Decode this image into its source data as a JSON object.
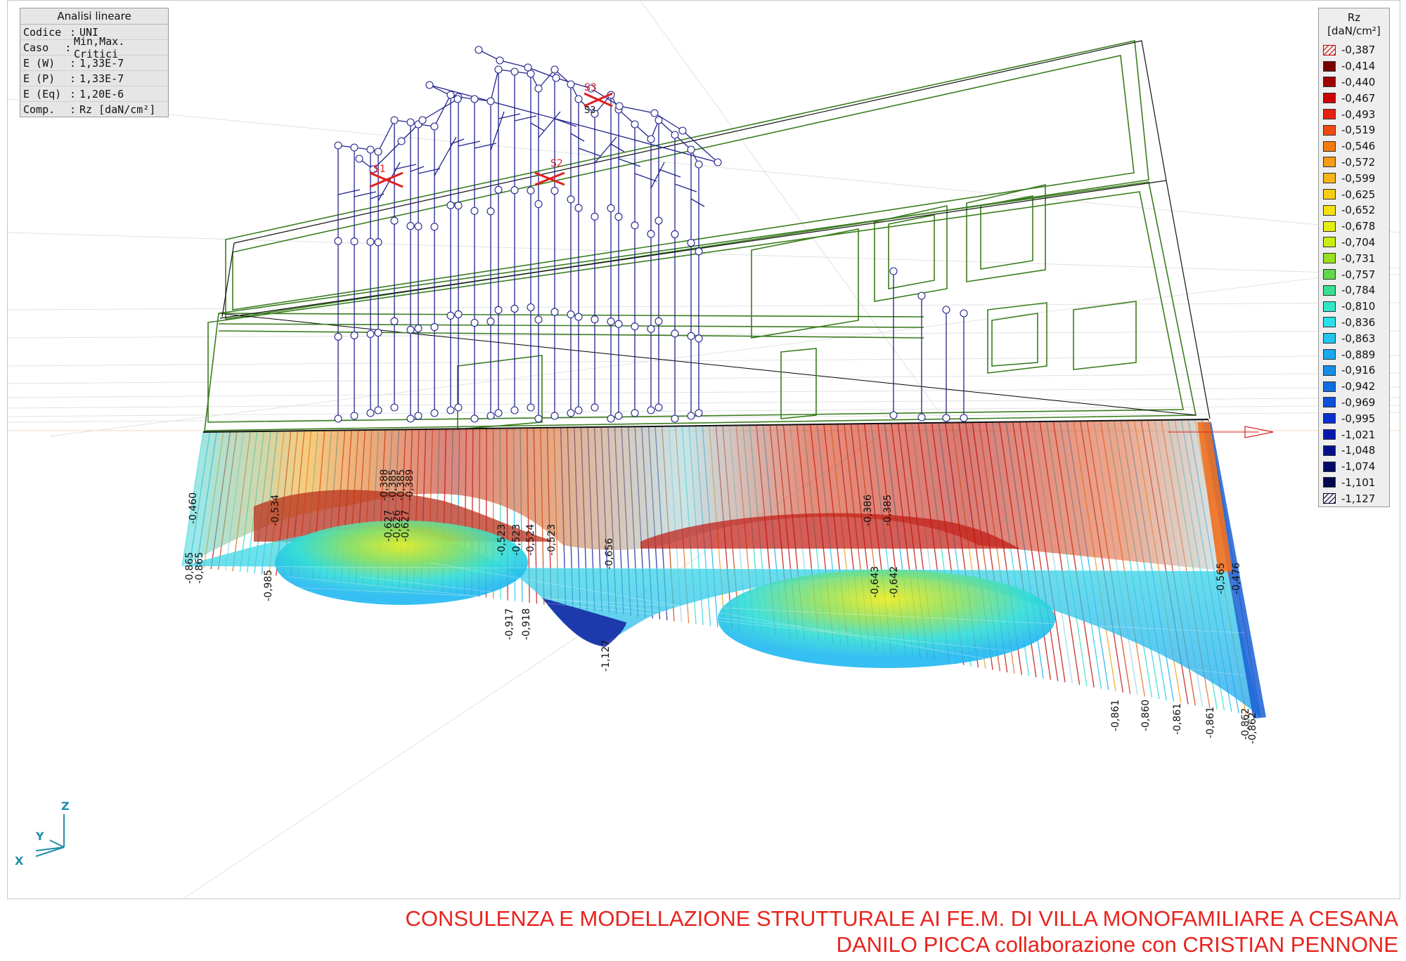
{
  "info_panel": {
    "title": "Analisi lineare",
    "rows": [
      {
        "key": "Codice",
        "value": "UNI"
      },
      {
        "key": "Caso",
        "value": "Min,Max. Critici"
      },
      {
        "key": "E (W)",
        "value": "1,33E-7"
      },
      {
        "key": "E (P)",
        "value": "1,33E-7"
      },
      {
        "key": "E (Eq)",
        "value": "1,20E-6"
      },
      {
        "key": "Comp.",
        "value": "Rz [daN/cm²]"
      }
    ]
  },
  "legend": {
    "title": "Rz",
    "unit": "[daN/cm²]",
    "items": [
      {
        "label": "-0,387",
        "color": "#c00000",
        "hatch": true
      },
      {
        "label": "-0,414",
        "color": "#7a0000"
      },
      {
        "label": "-0,440",
        "color": "#a00000"
      },
      {
        "label": "-0,467",
        "color": "#cc0000"
      },
      {
        "label": "-0,493",
        "color": "#e82010"
      },
      {
        "label": "-0,519",
        "color": "#f04a10"
      },
      {
        "label": "-0,546",
        "color": "#f57a10"
      },
      {
        "label": "-0,572",
        "color": "#f79a18"
      },
      {
        "label": "-0,599",
        "color": "#f8b418"
      },
      {
        "label": "-0,625",
        "color": "#f9cc14"
      },
      {
        "label": "-0,652",
        "color": "#f4e010"
      },
      {
        "label": "-0,678",
        "color": "#e4ee10"
      },
      {
        "label": "-0,704",
        "color": "#c6ee10"
      },
      {
        "label": "-0,731",
        "color": "#98e020"
      },
      {
        "label": "-0,757",
        "color": "#60d84a"
      },
      {
        "label": "-0,784",
        "color": "#38e090"
      },
      {
        "label": "-0,810",
        "color": "#30e8c8"
      },
      {
        "label": "-0,836",
        "color": "#28e0e8"
      },
      {
        "label": "-0,863",
        "color": "#22c4f0"
      },
      {
        "label": "-0,889",
        "color": "#1aa8f0"
      },
      {
        "label": "-0,916",
        "color": "#148ce8"
      },
      {
        "label": "-0,942",
        "color": "#106ee0"
      },
      {
        "label": "-0,969",
        "color": "#0c52d8"
      },
      {
        "label": "-0,995",
        "color": "#0830d0"
      },
      {
        "label": "-1,021",
        "color": "#0418b0"
      },
      {
        "label": "-1,048",
        "color": "#02108c"
      },
      {
        "label": "-1,074",
        "color": "#010a6a"
      },
      {
        "label": "-1,101",
        "color": "#000650"
      },
      {
        "label": "-1,127",
        "color": "#000038",
        "hatch": true
      }
    ]
  },
  "value_labels": {
    "upper": [
      "-0,460",
      "-0,534",
      "-0,388",
      "-0,385",
      "-0,385",
      "-0,389",
      "-0,627",
      "-0,626",
      "-0,627",
      "-0,523",
      "-0,523",
      "-0,524",
      "-0,523",
      "-0,656",
      "-0,386",
      "-0,385"
    ],
    "lower": [
      "-0,865",
      "-0,865",
      "-0,985",
      "-0,917",
      "-0,918",
      "-1,127",
      "-0,643",
      "-0,642",
      "-0,565",
      "-0,476",
      "-0,861",
      "-0,860",
      "-0,861",
      "-0,861",
      "-0,862",
      "-0,862"
    ]
  },
  "section_labels": [
    "S1",
    "S2",
    "S3",
    "S3"
  ],
  "axis_triad": {
    "z": "Z",
    "y": "Y",
    "x": "X"
  },
  "footer": {
    "line1": "CONSULENZA E MODELLAZIONE STRUTTURALE AI FE.M. DI VILLA MONOFAMILIARE A CESANA",
    "line2": "DANILO PICCA collaborazione con CRISTIAN PENNONE"
  },
  "colors": {
    "wireframe_green": "#3a7d1e",
    "frame_blue": "#23238c",
    "footer_red": "#e8231d",
    "axis_teal": "#1f8ea8"
  }
}
